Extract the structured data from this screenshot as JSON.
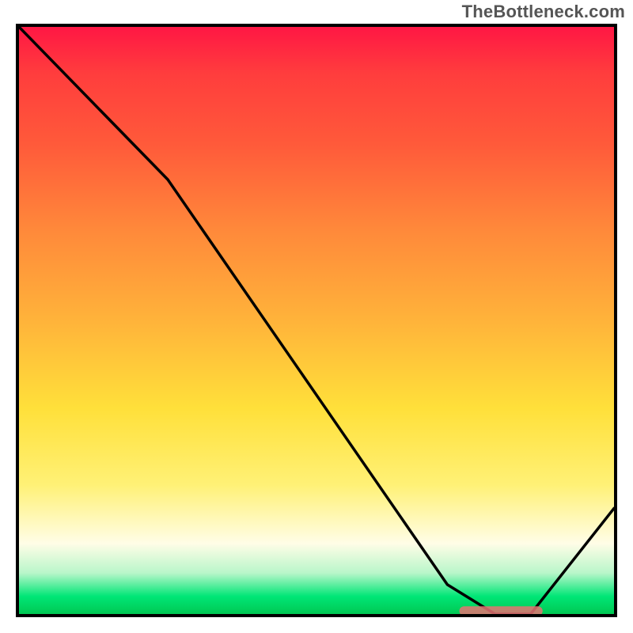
{
  "watermark": "TheBottleneck.com",
  "chart_data": {
    "type": "line",
    "title": "",
    "xlabel": "",
    "ylabel": "",
    "xlim": [
      0,
      100
    ],
    "ylim": [
      0,
      100
    ],
    "grid": false,
    "series": [
      {
        "name": "bottleneck-curve",
        "x": [
          0,
          25,
          72,
          80,
          86,
          100
        ],
        "values": [
          100,
          74,
          5,
          0,
          0,
          18
        ]
      }
    ],
    "annotations": [
      {
        "name": "optimal-zone-marker",
        "shape": "rounded-bar",
        "x_start": 74,
        "x_end": 88,
        "y": 0.5,
        "color": "#e57373"
      }
    ],
    "background_gradient": {
      "orientation": "vertical",
      "stops": [
        {
          "pos": 0.0,
          "color": "#ff1744"
        },
        {
          "pos": 0.2,
          "color": "#ff5a3a"
        },
        {
          "pos": 0.5,
          "color": "#ffb33a"
        },
        {
          "pos": 0.78,
          "color": "#fff176"
        },
        {
          "pos": 0.93,
          "color": "#b9f6ca"
        },
        {
          "pos": 1.0,
          "color": "#00c853"
        }
      ]
    }
  }
}
